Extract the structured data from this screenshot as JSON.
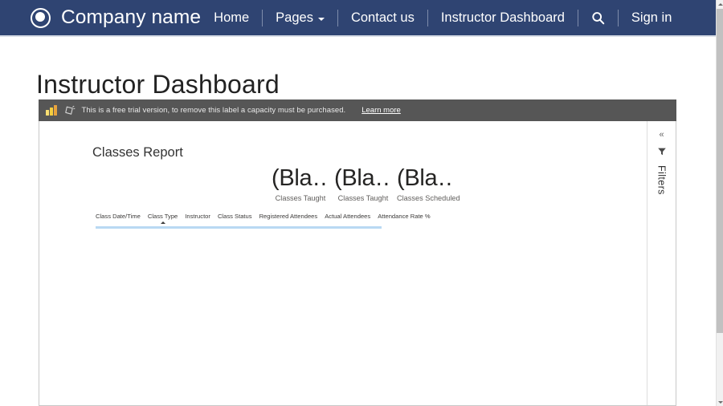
{
  "navbar": {
    "brand": "Company name",
    "brand_icon": "circle-target-logo-icon",
    "items": [
      {
        "label": "Home",
        "icon": null
      },
      {
        "label": "Pages",
        "icon": "chevron-down-icon"
      },
      {
        "label": "Contact us",
        "icon": null
      },
      {
        "label": "Instructor Dashboard",
        "icon": null
      }
    ],
    "search_icon": "search-icon",
    "signin_label": "Sign in"
  },
  "page": {
    "title": "Instructor Dashboard"
  },
  "trial_banner": {
    "product_icon": "power-bi-logo-icon",
    "trial_icon": "diamond-trial-icon",
    "message": "This is a free trial version, to remove this label a capacity must be purchased.",
    "link_label": "Learn more"
  },
  "report": {
    "title": "Classes Report",
    "kpis": [
      {
        "value": "(Bla…",
        "label": "Classes Taught"
      },
      {
        "value": "(Bla…",
        "label": "Classes Taught"
      },
      {
        "value": "(Bla…",
        "label": "Classes Scheduled"
      }
    ],
    "table": {
      "columns": [
        {
          "label": "Class Date/Time",
          "sorted": false
        },
        {
          "label": "Class Type",
          "sorted": true
        },
        {
          "label": "Instructor",
          "sorted": false
        },
        {
          "label": "Class Status",
          "sorted": false
        },
        {
          "label": "Registered Attendees",
          "sorted": false
        },
        {
          "label": "Actual Attendees",
          "sorted": false
        },
        {
          "label": "Attendance Rate %",
          "sorted": false
        }
      ],
      "rows": []
    },
    "filters_pane": {
      "collapse_icon": "chevron-double-left-icon",
      "filter_icon": "filter-funnel-icon",
      "label": "Filters"
    }
  },
  "colors": {
    "navbar_bg": "#2f4472",
    "trial_bar_bg": "#565656",
    "accent_rule": "#b9d9f3",
    "power_bi_yellow": "#f2c811"
  }
}
